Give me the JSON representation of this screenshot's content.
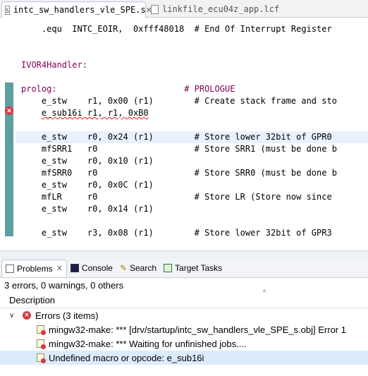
{
  "editor_tabs": [
    {
      "label": "intc_sw_handlers_vle_SPE.s",
      "icon": "asm-file-icon",
      "close": "✕"
    },
    {
      "label": "linkfile_ecu04z_app.lcf",
      "icon": "file-icon"
    }
  ],
  "code_lines": [
    {
      "text": "    .equ  INTC_EOIR,  0xfff48018  # End Of Interrupt Register"
    },
    {
      "text": ""
    },
    {
      "text": ""
    },
    {
      "text": "IVOR4Handler:"
    },
    {
      "text": ""
    },
    {
      "text": "prolog:                         # PROLOGUE"
    },
    {
      "text": "    e_stw    r1, 0x00 (r1)        # Create stack frame and sto"
    },
    {
      "text_a": "    ",
      "text_b": "e_sub16i r1, r1, 0xB0",
      "error": true
    },
    {
      "text": ""
    },
    {
      "text": "    e_stw    r0, 0x24 (r1)        # Store lower 32bit of GPR0 "
    },
    {
      "text": "    mfSRR1   r0                   # Store SRR1 (must be done b"
    },
    {
      "text": "    e_stw    r0, 0x10 (r1)"
    },
    {
      "text": "    mfSRR0   r0                   # Store SRR0 (must be done b"
    },
    {
      "text": "    e_stw    r0, 0x0C (r1)"
    },
    {
      "text": "    mfLR     r0                   # Store LR (Store now since "
    },
    {
      "text": "    e_stw    r0, 0x14 (r1)"
    },
    {
      "text": ""
    },
    {
      "text": ""
    },
    {
      "text": "    e_stw    r3, 0x08 (r1)        # Store lower 32bit of GPR3 "
    }
  ],
  "hscroll_arrow": "◀",
  "views": [
    {
      "label": "Problems",
      "close": "✕"
    },
    {
      "label": "Console"
    },
    {
      "label": "Search"
    },
    {
      "label": "Target Tasks"
    }
  ],
  "problems": {
    "summary": "3 errors, 0 warnings, 0 others",
    "column": "Description",
    "group": {
      "label": "Errors (3 items)",
      "chevron": "∨"
    },
    "items": [
      {
        "text": "mingw32-make: *** [drv/startup/intc_sw_handlers_vle_SPE_s.obj] Error 1"
      },
      {
        "text": "mingw32-make: *** Waiting for unfinished jobs...."
      },
      {
        "text": "Undefined macro or opcode: e_sub16i"
      }
    ]
  }
}
